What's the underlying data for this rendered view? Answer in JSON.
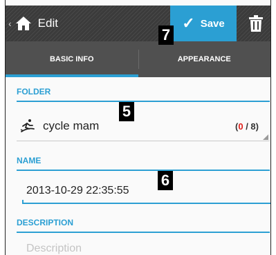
{
  "actionbar": {
    "back_glyph": "‹",
    "title": "Edit",
    "save_label": "Save",
    "colors": {
      "background": "#3b3b3b",
      "save_background": "#2b9fd3"
    },
    "icons": {
      "home": "home-icon",
      "save": "check-icon",
      "delete": "trash-icon"
    }
  },
  "tabs": [
    {
      "label": "BASIC INFO",
      "active": true
    },
    {
      "label": "APPEARANCE",
      "active": false
    }
  ],
  "folder": {
    "header": "FOLDER",
    "value": "cycle mam",
    "icon": "cyclist-icon",
    "count_current": "0",
    "count_sep": " / ",
    "count_total": "8",
    "count_open": "(",
    "count_close": ")"
  },
  "name": {
    "header": "NAME",
    "value": "2013-10-29 22:35:55"
  },
  "description": {
    "header": "DESCRIPTION",
    "placeholder": "Description"
  },
  "annotations": {
    "save": "7",
    "folder": "5",
    "name": "6"
  },
  "accent_color": "#2b9fd3"
}
